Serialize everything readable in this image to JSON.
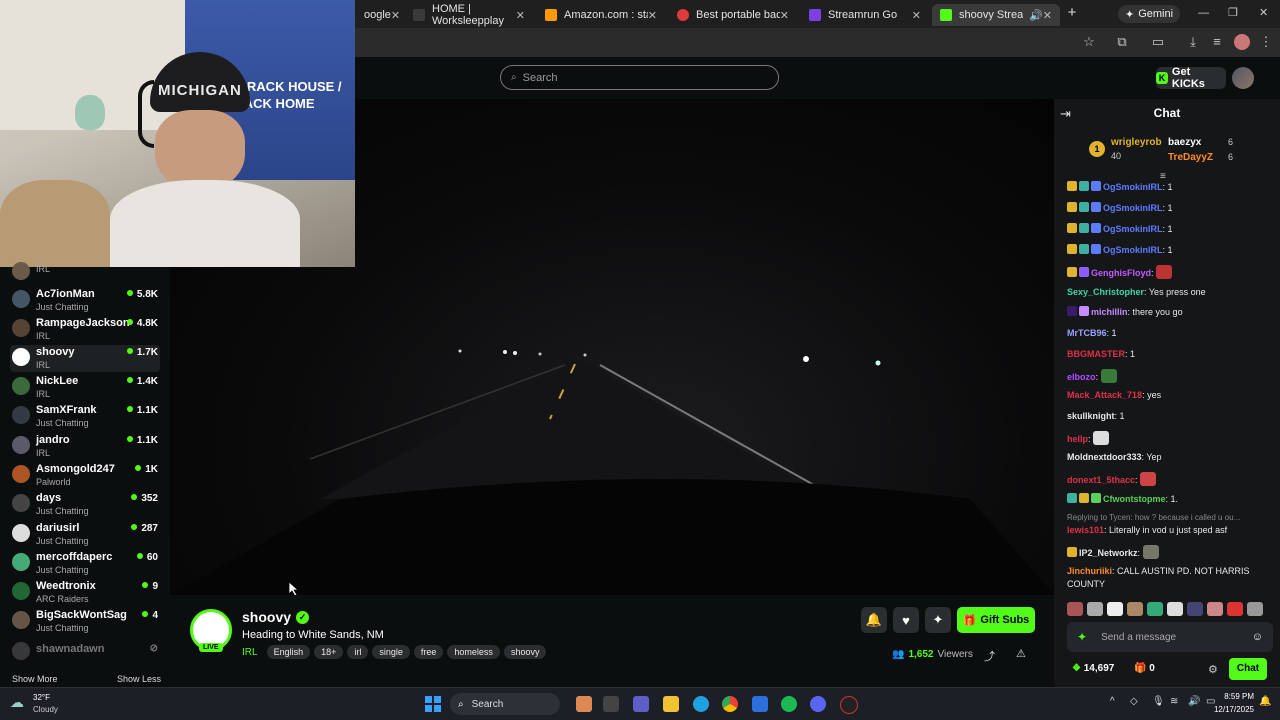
{
  "browser": {
    "tabs": [
      {
        "title": "oogle",
        "fav_color": "#4285f4"
      },
      {
        "title": "HOME | Worksleepplay",
        "fav_color": "#3a3a3a"
      },
      {
        "title": "Amazon.com : starlink l",
        "fav_color": "#ff9900"
      },
      {
        "title": "Best portable backpack",
        "fav_color": "#e03a3a"
      },
      {
        "title": "Streamrun Go",
        "fav_color": "#7b3fe4"
      },
      {
        "title": "shoovy Stream - Wa",
        "fav_color": "#53fc18"
      }
    ],
    "new_tab": "+",
    "gemini_label": "Gemini",
    "close_glyph": "✕"
  },
  "site": {
    "search_placeholder": "Search",
    "get_kicks_label": "Get KICKs"
  },
  "webcam": {
    "hat_text": "MICHIGAN",
    "poster_text": "A CRACK HOUSE / CRACK HOME"
  },
  "sidebar": {
    "channels": [
      {
        "name": "",
        "category": "IRL",
        "viewers": "",
        "avatar_color": "#6a5a4a"
      },
      {
        "name": "Ac7ionMan",
        "category": "Just Chatting",
        "viewers": "5.8K",
        "avatar_color": "#445566"
      },
      {
        "name": "RampageJackson",
        "category": "IRL",
        "viewers": "4.8K",
        "avatar_color": "#554433"
      },
      {
        "name": "shoovy",
        "category": "IRL",
        "viewers": "1.7K",
        "avatar_color": "#ffffff",
        "selected": true
      },
      {
        "name": "NickLee",
        "category": "IRL",
        "viewers": "1.4K",
        "avatar_color": "#3a6a3a"
      },
      {
        "name": "SamXFrank",
        "category": "Just Chatting",
        "viewers": "1.1K",
        "avatar_color": "#333a44"
      },
      {
        "name": "jandro",
        "category": "IRL",
        "viewers": "1.1K",
        "avatar_color": "#5a5a6a"
      },
      {
        "name": "Asmongold247",
        "category": "Palworld",
        "viewers": "1K",
        "avatar_color": "#aa5522"
      },
      {
        "name": "days",
        "category": "Just Chatting",
        "viewers": "352",
        "avatar_color": "#444"
      },
      {
        "name": "dariusirl",
        "category": "Just Chatting",
        "viewers": "287",
        "avatar_color": "#ddd"
      },
      {
        "name": "mercoffdaperc",
        "category": "Just Chatting",
        "viewers": "60",
        "avatar_color": "#44aa77"
      },
      {
        "name": "Weedtronix",
        "category": "ARC Raiders",
        "viewers": "9",
        "avatar_color": "#226633"
      },
      {
        "name": "BigSackWontSag",
        "category": "Just Chatting",
        "viewers": "4",
        "avatar_color": "#665544"
      }
    ],
    "offline_channel": "shawnadawn",
    "show_more": "Show More",
    "show_less": "Show Less"
  },
  "stream": {
    "streamer": "shoovy",
    "title": "Heading to White Sands, NM",
    "category": "IRL",
    "live_badge": "LIVE",
    "tags": [
      "English",
      "18+",
      "irl",
      "single",
      "free",
      "homeless",
      "shoovy"
    ],
    "gift_subs_label": "Gift Subs",
    "viewers": "1,652",
    "viewers_label": "Viewers"
  },
  "chat": {
    "title": "Chat",
    "leaderboard": [
      {
        "name": "wrigleyrob",
        "count": "40"
      },
      {
        "name": "baezyx",
        "count": "6"
      },
      {
        "name": "TreDayyZ",
        "count": "6"
      }
    ],
    "messages": [
      {
        "user": "OgSmokinIRL",
        "text": " 1",
        "color": "#5b7cff"
      },
      {
        "user": "OgSmokinIRL",
        "text": " 1",
        "color": "#5b7cff"
      },
      {
        "user": "OgSmokinIRL",
        "text": " 1",
        "color": "#5b7cff"
      },
      {
        "user": "OgSmokinIRL",
        "text": " 1",
        "color": "#5b7cff"
      },
      {
        "user": "GenghisFloyd",
        "text": " ",
        "color": "#c05cff"
      },
      {
        "user": "Sexy_Christopher",
        "text": " Yes press one",
        "color": "#3fd6a8"
      },
      {
        "user": "michillin",
        "text": " there you go",
        "color": "#c48cff"
      },
      {
        "user": "MrTCB96",
        "text": " 1",
        "color": "#9aa3ff"
      },
      {
        "user": "BBGMASTER",
        "text": " 1",
        "color": "#e0304a"
      },
      {
        "user": "elbozo",
        "text": " ",
        "color": "#b44cff"
      },
      {
        "user": "Mack_Attack_718",
        "text": " yes",
        "color": "#e0304a"
      },
      {
        "user": "skullknight",
        "text": " 1",
        "color": "#e8e8e8"
      },
      {
        "user": "hellp",
        "text": " ",
        "color": "#e0304a"
      },
      {
        "user": "Moldnextdoor333",
        "text": " Yep",
        "color": "#e8e8e8"
      },
      {
        "user": "donext1_5thacc",
        "text": " ",
        "color": "#e0304a"
      },
      {
        "user": "Cfwontstopme",
        "text": " 1.",
        "color": "#5bd05b"
      },
      {
        "user": "lewis101",
        "text": " Literally in vod u just sped asf",
        "color": "#e0304a"
      },
      {
        "user": "IP2_Networkz",
        "text": " ",
        "color": "#e8e8e8"
      },
      {
        "user": "Jinchuriiki",
        "text": " CALL AUSTIN PD. NOT HARRIS COUNTY",
        "color": "#ff8c2a"
      }
    ],
    "reply_prefix": "Replying to Tycen: how ? because i called u ou...",
    "input_placeholder": "Send a message",
    "kicks_balance": "14,697",
    "gifts_count": "0",
    "send_label": "Chat"
  },
  "taskbar": {
    "weather_temp": "32°F",
    "weather_desc": "Cloudy",
    "search_label": "Search",
    "time": "8:59 PM",
    "date": "12/17/2025"
  }
}
